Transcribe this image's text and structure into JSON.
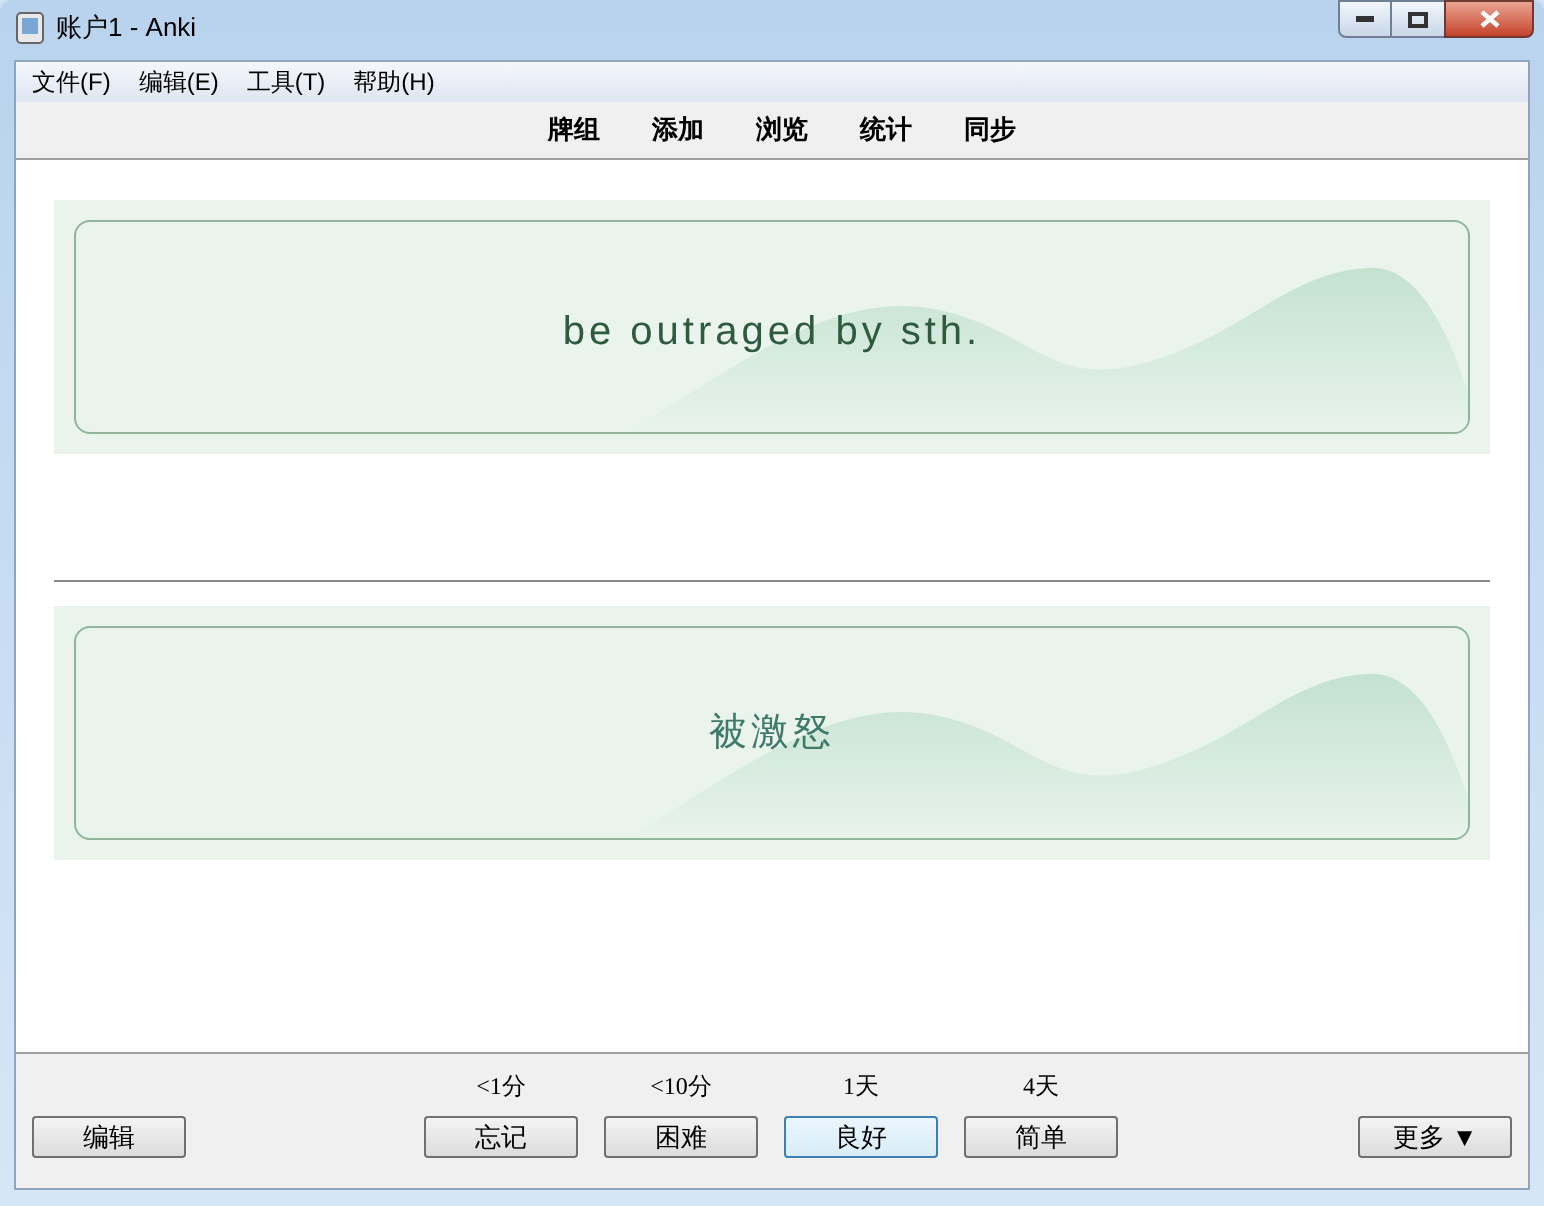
{
  "window": {
    "title": "账户1 - Anki"
  },
  "menu": [
    "文件(F)",
    "编辑(E)",
    "工具(T)",
    "帮助(H)"
  ],
  "toolbar": [
    "牌组",
    "添加",
    "浏览",
    "统计",
    "同步"
  ],
  "cards": [
    {
      "kind": "front",
      "text": "be outraged by sth."
    },
    {
      "kind": "back",
      "text": "被激怒"
    }
  ],
  "bottom": {
    "edit_button": "编辑",
    "answers": [
      {
        "interval": "<1分",
        "label": "忘记",
        "default": false
      },
      {
        "interval": "<10分",
        "label": "困难",
        "default": false
      },
      {
        "interval": "1天",
        "label": "良好",
        "default": true
      },
      {
        "interval": "4天",
        "label": "简单",
        "default": false
      }
    ],
    "more_button": "更多 ▼"
  }
}
